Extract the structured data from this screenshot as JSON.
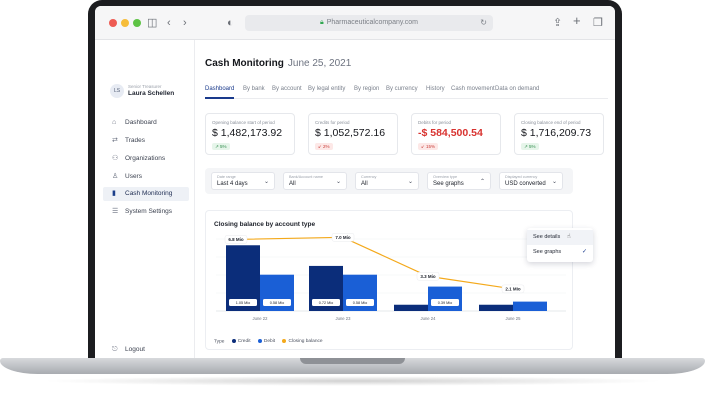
{
  "browser": {
    "url": "Pharmaceuticalcompany.com",
    "icons": [
      "sidebar-toggle-icon",
      "back-icon",
      "forward-icon",
      "shield-icon",
      "lock-icon",
      "reload-icon",
      "share-icon",
      "new-tab-icon",
      "tabs-icon"
    ]
  },
  "user": {
    "initials": "LS",
    "role": "Senior Treasurer",
    "name": "Laura Schellen"
  },
  "sidebar": {
    "items": [
      {
        "label": "Dashboard",
        "icon": "home-icon",
        "glyph": "⌂"
      },
      {
        "label": "Trades",
        "icon": "trades-icon",
        "glyph": "⇄"
      },
      {
        "label": "Organizations",
        "icon": "organizations-icon",
        "glyph": "⚇"
      },
      {
        "label": "Users",
        "icon": "user-icon",
        "glyph": "♙"
      },
      {
        "label": "Cash Monitoring",
        "icon": "bar-chart-icon",
        "glyph": "▮"
      },
      {
        "label": "System Settings",
        "icon": "sliders-icon",
        "glyph": "☰"
      }
    ],
    "active": "Cash Monitoring",
    "logout": "Logout"
  },
  "header": {
    "title": "Cash Monitoring",
    "date": "June 25, 2021"
  },
  "tabs": [
    "Dashboard",
    "By bank",
    "By account",
    "By legal entity",
    "By region",
    "By currency",
    "History",
    "Cash movement",
    "Data on demand"
  ],
  "cards": [
    {
      "label": "Opening balance start of period",
      "value": "$ 1,482,173.92",
      "change": "↗ 5%",
      "trend": "up"
    },
    {
      "label": "Credits for period",
      "value": "$ 1,052,572.16",
      "change": "↙ 2%",
      "trend": "down"
    },
    {
      "label": "Debits for period",
      "value": "-$ 584,500.54",
      "change": "↙ 15%",
      "trend": "down"
    },
    {
      "label": "Closing balance end of period",
      "value": "$ 1,716,209.73",
      "change": "↗ 5%",
      "trend": "up"
    }
  ],
  "filters": [
    {
      "label": "Date range",
      "value": "Last 4 days",
      "chevron": "⌄"
    },
    {
      "label": "Bank/Account name",
      "value": "All",
      "chevron": "⌄"
    },
    {
      "label": "Currency",
      "value": "All",
      "chevron": "⌄"
    },
    {
      "label": "Overview type",
      "value": "See graphs",
      "chevron": "⌃"
    },
    {
      "label": "Displayed currency",
      "value": "USD converted",
      "chevron": "⌄"
    }
  ],
  "dropdown": {
    "options": [
      "See details",
      "See graphs"
    ],
    "selected": "See graphs",
    "hovered": "See details"
  },
  "chart_title": "Closing balance by account type",
  "legend": {
    "label": "Type",
    "items": [
      "Credit",
      "Debit",
      "Closing balance"
    ]
  },
  "colors": {
    "credit": "#0b2d7a",
    "debit": "#1a5fd6",
    "closing": "#f4a91b",
    "accent": "#1a3a8c"
  },
  "chart_data": {
    "type": "bar",
    "categories": [
      "June 22",
      "June 23",
      "June 24",
      "June 25"
    ],
    "series": [
      {
        "name": "Credit",
        "values": [
          1.05,
          0.72,
          0.1,
          0.1
        ],
        "labels": [
          "1.05 Mio",
          "0.72 Mio",
          "",
          ""
        ]
      },
      {
        "name": "Debit",
        "values": [
          0.58,
          0.58,
          0.39,
          0.15
        ],
        "labels": [
          "0.58 Mio",
          "0.58 Mio",
          "0.39 Mio",
          ""
        ]
      },
      {
        "name": "Closing balance",
        "type": "line",
        "values": [
          6.8,
          7.0,
          3.3,
          2.1
        ],
        "labels": [
          "6.8 Mio",
          "7.0 Mio",
          "3.3 Mio",
          "2.1 Mio"
        ]
      }
    ],
    "bar_scale": [
      0,
      1.15
    ],
    "line_scale": [
      0,
      7.6
    ]
  }
}
